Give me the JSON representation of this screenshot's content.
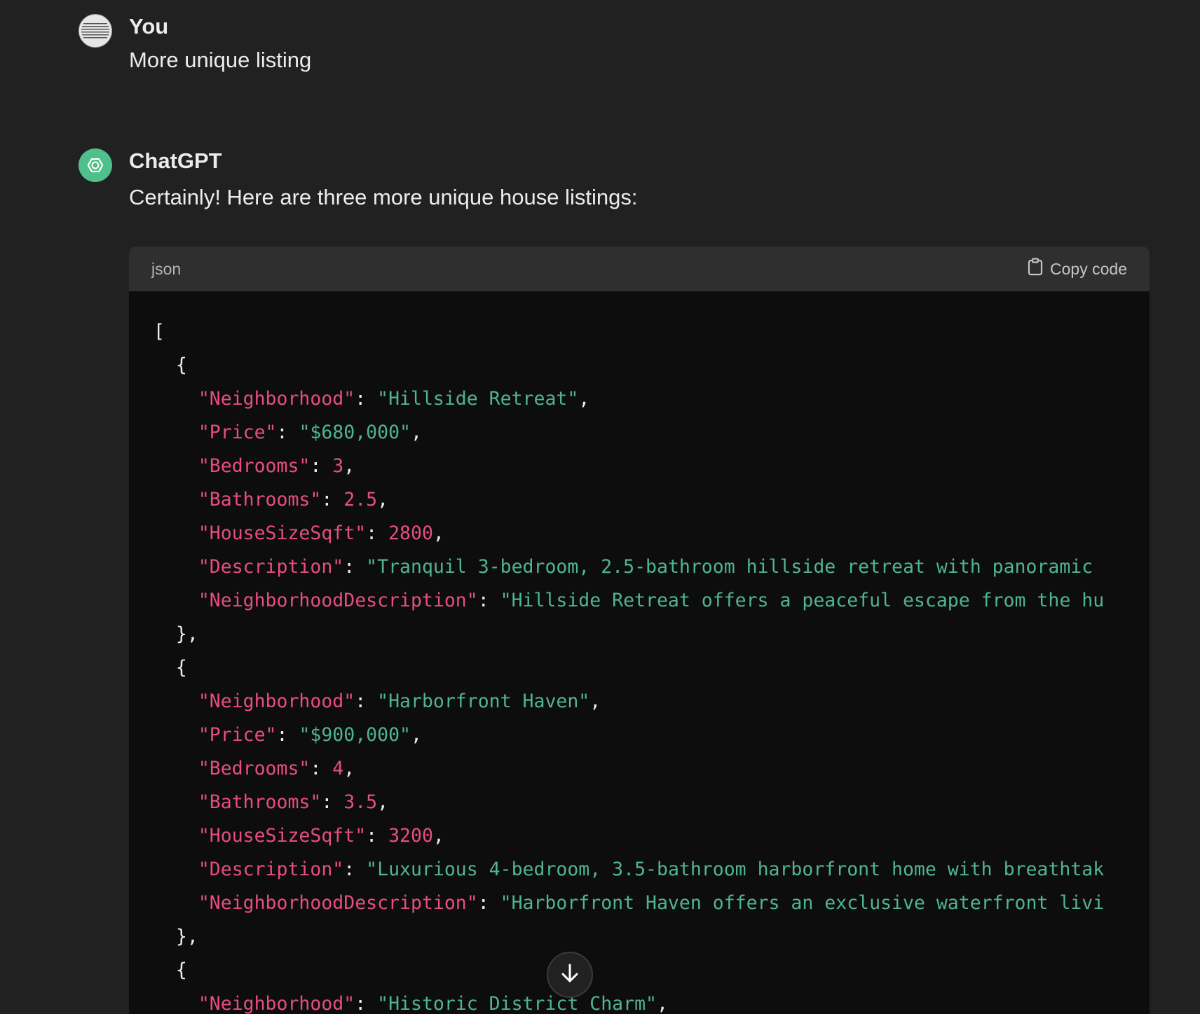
{
  "user_message": {
    "author": "You",
    "text": "More unique listing"
  },
  "assistant_message": {
    "author": "ChatGPT",
    "intro": "Certainly! Here are three more unique house listings:"
  },
  "code_block": {
    "language": "json",
    "copy_label": "Copy code",
    "lines": [
      [
        {
          "t": "p",
          "v": "["
        }
      ],
      [
        {
          "t": "p",
          "v": "  {"
        }
      ],
      [
        {
          "t": "p",
          "v": "    "
        },
        {
          "t": "k",
          "v": "\"Neighborhood\""
        },
        {
          "t": "p",
          "v": ": "
        },
        {
          "t": "s",
          "v": "\"Hillside Retreat\""
        },
        {
          "t": "p",
          "v": ","
        }
      ],
      [
        {
          "t": "p",
          "v": "    "
        },
        {
          "t": "k",
          "v": "\"Price\""
        },
        {
          "t": "p",
          "v": ": "
        },
        {
          "t": "s",
          "v": "\"$680,000\""
        },
        {
          "t": "p",
          "v": ","
        }
      ],
      [
        {
          "t": "p",
          "v": "    "
        },
        {
          "t": "k",
          "v": "\"Bedrooms\""
        },
        {
          "t": "p",
          "v": ": "
        },
        {
          "t": "n",
          "v": "3"
        },
        {
          "t": "p",
          "v": ","
        }
      ],
      [
        {
          "t": "p",
          "v": "    "
        },
        {
          "t": "k",
          "v": "\"Bathrooms\""
        },
        {
          "t": "p",
          "v": ": "
        },
        {
          "t": "n",
          "v": "2.5"
        },
        {
          "t": "p",
          "v": ","
        }
      ],
      [
        {
          "t": "p",
          "v": "    "
        },
        {
          "t": "k",
          "v": "\"HouseSizeSqft\""
        },
        {
          "t": "p",
          "v": ": "
        },
        {
          "t": "n",
          "v": "2800"
        },
        {
          "t": "p",
          "v": ","
        }
      ],
      [
        {
          "t": "p",
          "v": "    "
        },
        {
          "t": "k",
          "v": "\"Description\""
        },
        {
          "t": "p",
          "v": ": "
        },
        {
          "t": "s",
          "v": "\"Tranquil 3-bedroom, 2.5-bathroom hillside retreat with panoramic "
        }
      ],
      [
        {
          "t": "p",
          "v": "    "
        },
        {
          "t": "k",
          "v": "\"NeighborhoodDescription\""
        },
        {
          "t": "p",
          "v": ": "
        },
        {
          "t": "s",
          "v": "\"Hillside Retreat offers a peaceful escape from the hu"
        }
      ],
      [
        {
          "t": "p",
          "v": "  },"
        }
      ],
      [
        {
          "t": "p",
          "v": "  {"
        }
      ],
      [
        {
          "t": "p",
          "v": "    "
        },
        {
          "t": "k",
          "v": "\"Neighborhood\""
        },
        {
          "t": "p",
          "v": ": "
        },
        {
          "t": "s",
          "v": "\"Harborfront Haven\""
        },
        {
          "t": "p",
          "v": ","
        }
      ],
      [
        {
          "t": "p",
          "v": "    "
        },
        {
          "t": "k",
          "v": "\"Price\""
        },
        {
          "t": "p",
          "v": ": "
        },
        {
          "t": "s",
          "v": "\"$900,000\""
        },
        {
          "t": "p",
          "v": ","
        }
      ],
      [
        {
          "t": "p",
          "v": "    "
        },
        {
          "t": "k",
          "v": "\"Bedrooms\""
        },
        {
          "t": "p",
          "v": ": "
        },
        {
          "t": "n",
          "v": "4"
        },
        {
          "t": "p",
          "v": ","
        }
      ],
      [
        {
          "t": "p",
          "v": "    "
        },
        {
          "t": "k",
          "v": "\"Bathrooms\""
        },
        {
          "t": "p",
          "v": ": "
        },
        {
          "t": "n",
          "v": "3.5"
        },
        {
          "t": "p",
          "v": ","
        }
      ],
      [
        {
          "t": "p",
          "v": "    "
        },
        {
          "t": "k",
          "v": "\"HouseSizeSqft\""
        },
        {
          "t": "p",
          "v": ": "
        },
        {
          "t": "n",
          "v": "3200"
        },
        {
          "t": "p",
          "v": ","
        }
      ],
      [
        {
          "t": "p",
          "v": "    "
        },
        {
          "t": "k",
          "v": "\"Description\""
        },
        {
          "t": "p",
          "v": ": "
        },
        {
          "t": "s",
          "v": "\"Luxurious 4-bedroom, 3.5-bathroom harborfront home with breathtak"
        }
      ],
      [
        {
          "t": "p",
          "v": "    "
        },
        {
          "t": "k",
          "v": "\"NeighborhoodDescription\""
        },
        {
          "t": "p",
          "v": ": "
        },
        {
          "t": "s",
          "v": "\"Harborfront Haven offers an exclusive waterfront livi"
        }
      ],
      [
        {
          "t": "p",
          "v": "  },"
        }
      ],
      [
        {
          "t": "p",
          "v": "  {"
        }
      ],
      [
        {
          "t": "p",
          "v": "    "
        },
        {
          "t": "k",
          "v": "\"Neighborhood\""
        },
        {
          "t": "p",
          "v": ": "
        },
        {
          "t": "s",
          "v": "\"Historic District Charm\""
        },
        {
          "t": "p",
          "v": ","
        }
      ]
    ]
  },
  "icons": {
    "copy": "clipboard-icon",
    "scroll_down": "arrow-down-icon",
    "assistant_logo": "openai-logo-icon",
    "user_avatar": "user-avatar-icon"
  },
  "colors": {
    "background": "#212121",
    "code_background": "#0d0d0d",
    "code_header": "#2f2f2f",
    "key_color": "#e84d82",
    "string_color": "#4fb58e"
  }
}
